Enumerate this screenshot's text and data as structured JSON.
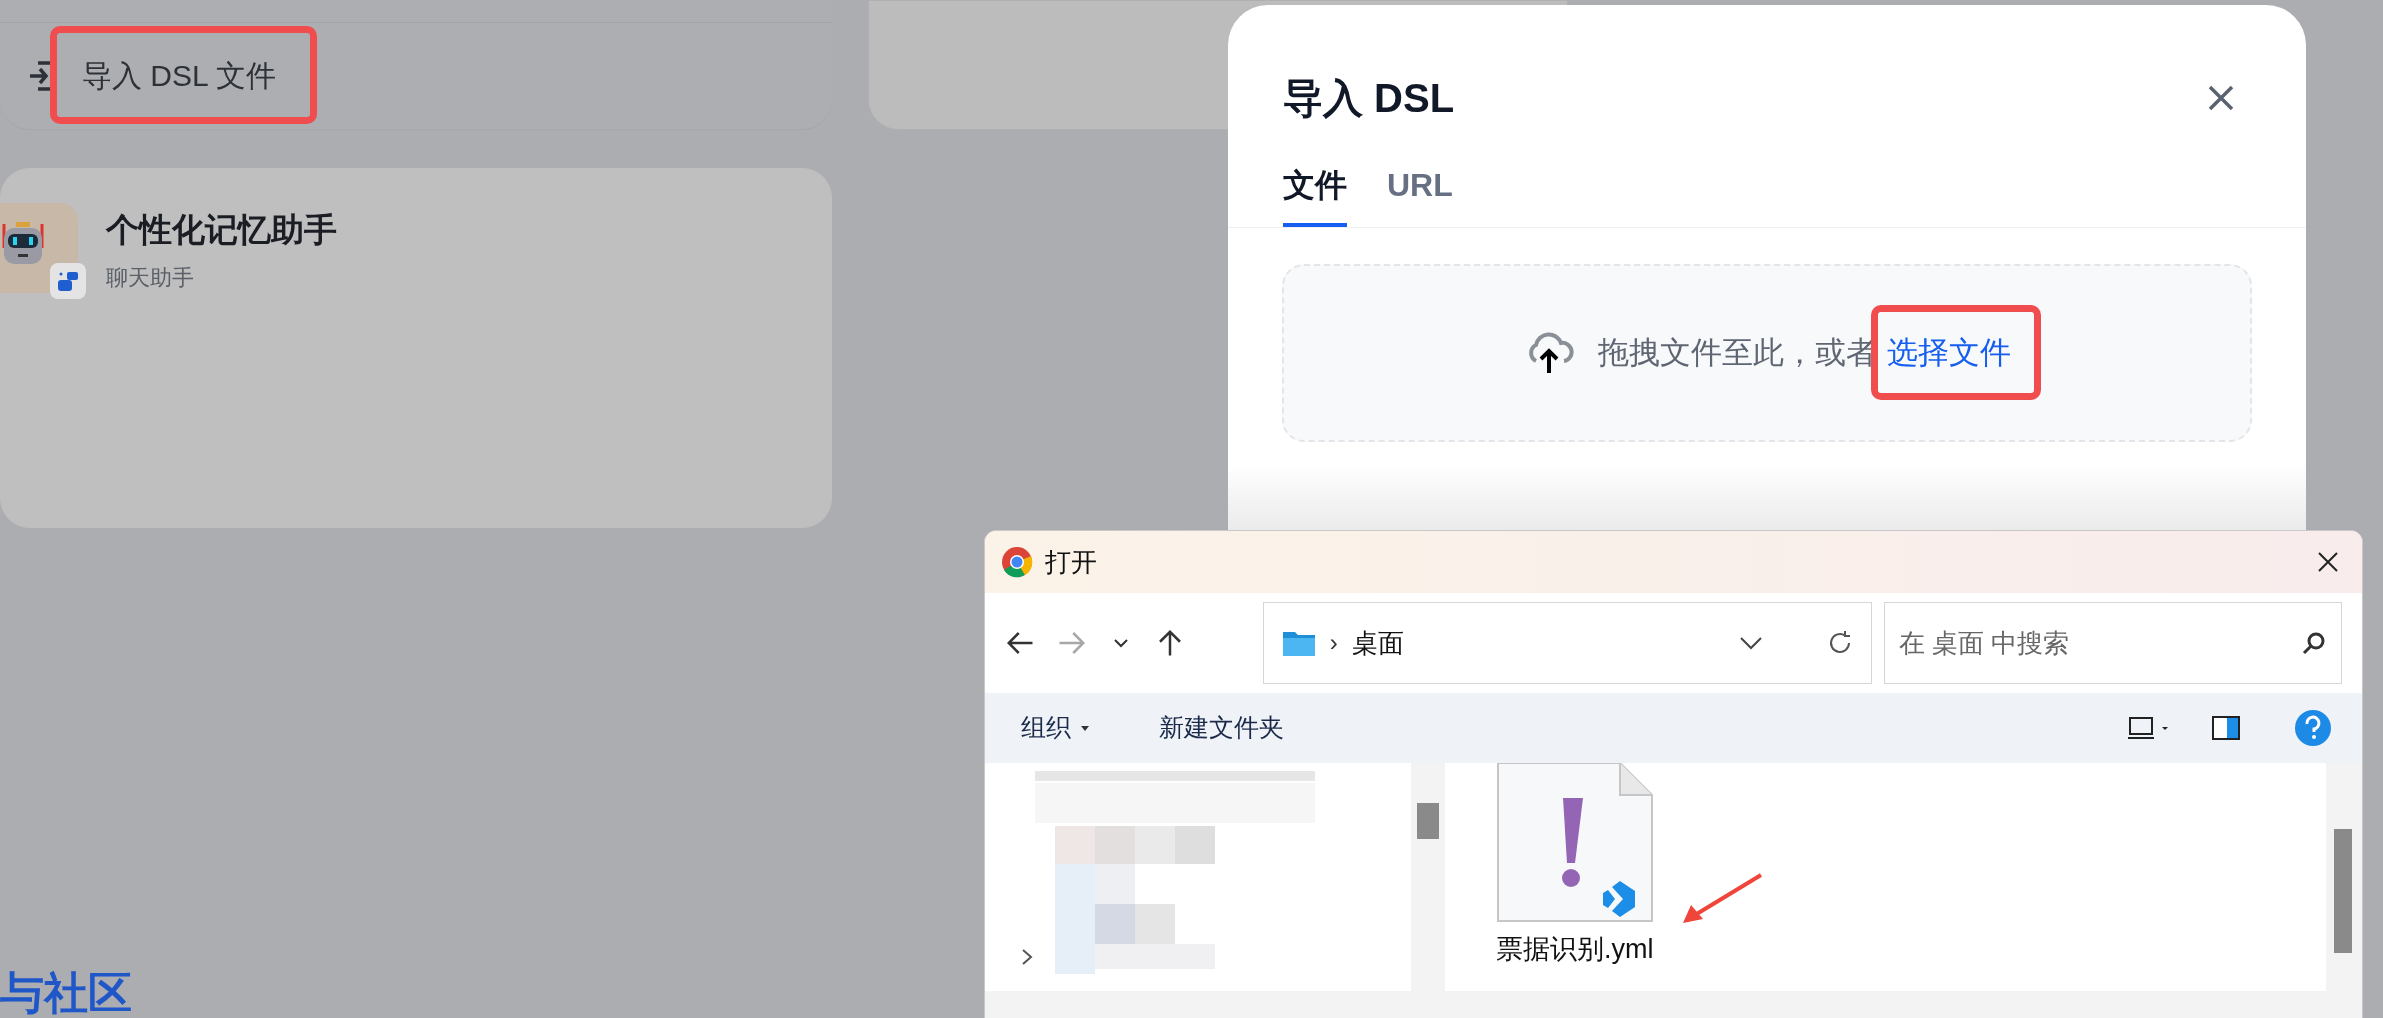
{
  "background": {
    "import_button": {
      "label": "导入 DSL 文件"
    },
    "app_card": {
      "title": "个性化记忆助手",
      "subtitle": "聊天助手"
    },
    "footer_text": "与社区"
  },
  "dialog": {
    "title": "导入 DSL",
    "tabs": [
      {
        "label": "文件",
        "selected": true
      },
      {
        "label": "URL",
        "selected": false
      }
    ],
    "dropzone": {
      "text": "拖拽文件至此，或者",
      "link": "选择文件"
    }
  },
  "file_dialog": {
    "title": "打开",
    "nav": [
      {
        "kind": "back",
        "disabled": false
      },
      {
        "kind": "forward",
        "disabled": true
      },
      {
        "kind": "recent",
        "disabled": false
      },
      {
        "kind": "up",
        "disabled": false
      }
    ],
    "breadcrumb_separator": "›",
    "breadcrumb": "桌面",
    "search": {
      "placeholder": "在 桌面 中搜索"
    },
    "toolbar": [
      {
        "label": "组织",
        "kind": "menu"
      },
      {
        "label": "新建文件夹",
        "kind": "button"
      }
    ],
    "files": [
      {
        "name": "票据识别.yml"
      }
    ]
  }
}
